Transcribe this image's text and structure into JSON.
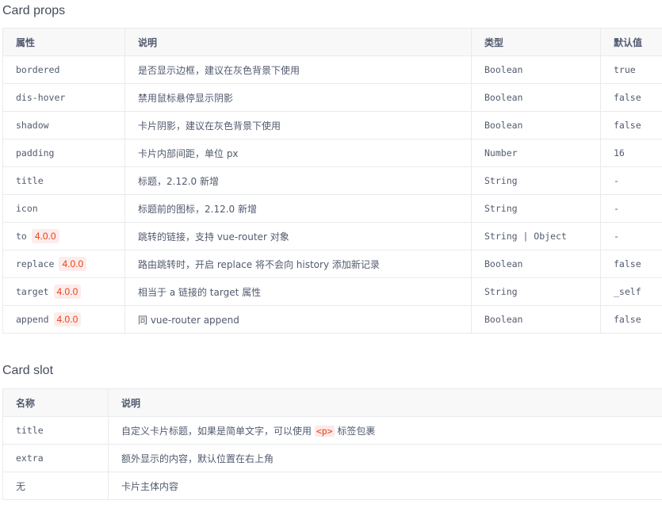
{
  "props": {
    "title": "Card props",
    "headers": [
      "属性",
      "说明",
      "类型",
      "默认值"
    ],
    "rows": [
      {
        "name": "bordered",
        "tag": "",
        "desc": "是否显示边框，建议在灰色背景下使用",
        "type": "Boolean",
        "default": "true"
      },
      {
        "name": "dis-hover",
        "tag": "",
        "desc": "禁用鼠标悬停显示阴影",
        "type": "Boolean",
        "default": "false"
      },
      {
        "name": "shadow",
        "tag": "",
        "desc": "卡片阴影，建议在灰色背景下使用",
        "type": "Boolean",
        "default": "false"
      },
      {
        "name": "padding",
        "tag": "",
        "desc": "卡片内部间距，单位 px",
        "type": "Number",
        "default": "16"
      },
      {
        "name": "title",
        "tag": "",
        "desc": "标题，2.12.0 新增",
        "type": "String",
        "default": "-"
      },
      {
        "name": "icon",
        "tag": "",
        "desc": "标题前的图标，2.12.0 新增",
        "type": "String",
        "default": "-"
      },
      {
        "name": "to",
        "tag": "4.0.0",
        "desc": "跳转的链接，支持 vue-router 对象",
        "type": "String | Object",
        "default": "-"
      },
      {
        "name": "replace",
        "tag": "4.0.0",
        "desc": "路由跳转时，开启 replace 将不会向 history 添加新记录",
        "type": "Boolean",
        "default": "false"
      },
      {
        "name": "target",
        "tag": "4.0.0",
        "desc": "相当于 a 链接的 target 属性",
        "type": "String",
        "default": "_self"
      },
      {
        "name": "append",
        "tag": "4.0.0",
        "desc": "同 vue-router append",
        "type": "Boolean",
        "default": "false"
      }
    ]
  },
  "slots": {
    "title": "Card slot",
    "headers": [
      "名称",
      "说明"
    ],
    "rows": [
      {
        "name": "title",
        "desc_before": "自定义卡片标题，如果是简单文字，可以使用 ",
        "desc_code": "<p>",
        "desc_after": " 标签包裹"
      },
      {
        "name": "extra",
        "desc_before": "额外显示的内容，默认位置在右上角",
        "desc_code": "",
        "desc_after": ""
      },
      {
        "name": "无",
        "desc_before": "卡片主体内容",
        "desc_code": "",
        "desc_after": ""
      }
    ]
  }
}
